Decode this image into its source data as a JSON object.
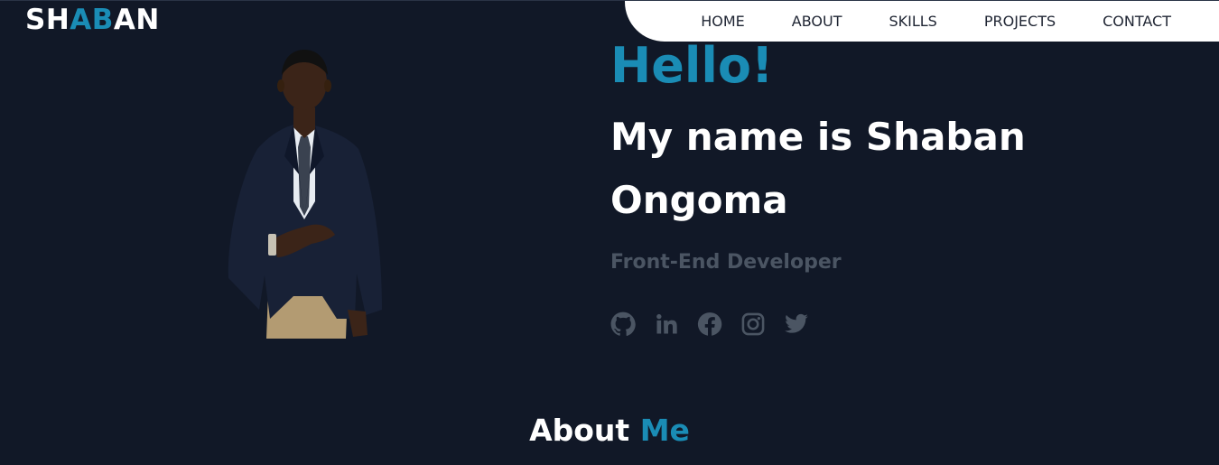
{
  "logo": {
    "part1": "SH",
    "part2": "AB",
    "part3": "AN"
  },
  "nav": {
    "items": [
      {
        "label": "HOME"
      },
      {
        "label": "ABOUT"
      },
      {
        "label": "SKILLS"
      },
      {
        "label": "PROJECTS"
      },
      {
        "label": "CONTACT"
      }
    ]
  },
  "hero": {
    "greeting": "Hello!",
    "name": "My name is Shaban Ongoma",
    "role": "Front-End Developer",
    "socials": [
      {
        "icon": "github-icon"
      },
      {
        "icon": "linkedin-icon"
      },
      {
        "icon": "facebook-icon"
      },
      {
        "icon": "instagram-icon"
      },
      {
        "icon": "twitter-icon"
      }
    ]
  },
  "about": {
    "title_main": "About",
    "title_accent": "Me"
  },
  "colors": {
    "background": "#111827",
    "accent": "#1a8cb5",
    "muted": "#4b5563",
    "nav_bg": "#ffffff"
  }
}
